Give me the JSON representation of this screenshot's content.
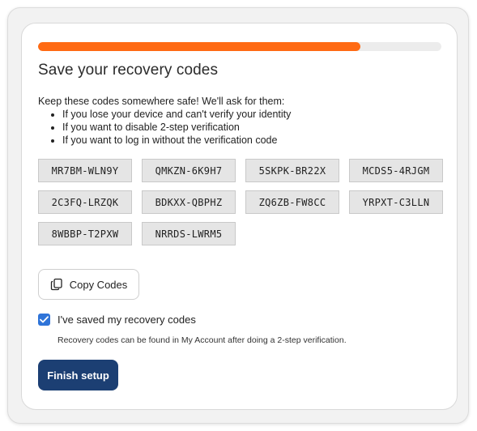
{
  "progress": {
    "fraction": 0.8,
    "color": "#ff6a13"
  },
  "title": "Save your recovery codes",
  "intro": "Keep these codes somewhere safe! We'll ask for them:",
  "reasons": [
    "If you lose your device and can't verify your identity",
    "If you want to disable 2-step verification",
    "If you want to log in without the verification code"
  ],
  "codes": [
    "MR7BM-WLN9Y",
    "QMKZN-6K9H7",
    "5SKPK-BR22X",
    "MCDS5-4RJGM",
    "2C3FQ-LRZQK",
    "BDKXX-QBPHZ",
    "ZQ6ZB-FW8CC",
    "YRPXT-C3LLN",
    "8WBBP-T2PXW",
    "NRRDS-LWRM5"
  ],
  "copy_button": {
    "label": "Copy Codes",
    "icon": "copy-icon"
  },
  "confirm": {
    "checked": true,
    "label": "I've saved my recovery codes",
    "hint": "Recovery codes can be found in My Account after doing a 2-step verification."
  },
  "finish_button": {
    "label": "Finish setup",
    "color": "#1c3f73"
  }
}
